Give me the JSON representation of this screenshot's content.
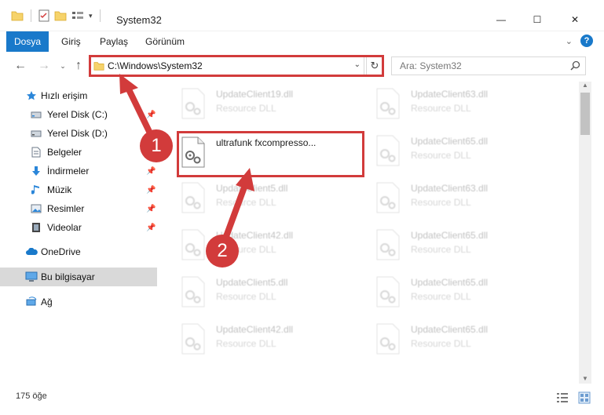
{
  "window": {
    "title": "System32",
    "minimize_glyph": "—",
    "maximize_glyph": "☐",
    "close_glyph": "✕"
  },
  "ribbon": {
    "tabs": [
      "Dosya",
      "Giriş",
      "Paylaş",
      "Görünüm"
    ],
    "accent_color": "#1979ca"
  },
  "navigation": {
    "address": "C:\\Windows\\System32",
    "search_placeholder": "Ara: System32"
  },
  "sidebar": {
    "items": [
      {
        "label": "Hızlı erişim",
        "icon": "star-icon"
      },
      {
        "label": "Yerel Disk (C:)",
        "icon": "drive-icon"
      },
      {
        "label": "Yerel Disk (D:)",
        "icon": "drive-icon"
      },
      {
        "label": "Belgeler",
        "icon": "documents-icon"
      },
      {
        "label": "İndirmeler",
        "icon": "download-icon"
      },
      {
        "label": "Müzik",
        "icon": "music-icon"
      },
      {
        "label": "Resimler",
        "icon": "pictures-icon"
      },
      {
        "label": "Videolar",
        "icon": "videos-icon"
      },
      {
        "label": "OneDrive",
        "icon": "cloud-icon"
      },
      {
        "label": "Bu bilgisayar",
        "icon": "computer-icon"
      },
      {
        "label": "Ağ",
        "icon": "network-icon"
      }
    ]
  },
  "files": {
    "highlighted": {
      "name": "ultrafunk fxcompresso..."
    },
    "left_column": [
      {
        "name": "UpdateClient19.dll",
        "type": "Resource DLL"
      },
      {
        "name": "UpdateClient5.dll",
        "type": "Resource DLL"
      },
      {
        "name": "UpdateClient42.dll",
        "type": "Resource DLL"
      },
      {
        "name": "UpdateClient5.dll",
        "type": "Resource DLL"
      },
      {
        "name": "UpdateClient42.dll",
        "type": "Resource DLL"
      }
    ],
    "right_column": [
      {
        "name": "UpdateClient63.dll",
        "type": "Resource DLL"
      },
      {
        "name": "UpdateClient65.dll",
        "type": "Resource DLL"
      },
      {
        "name": "UpdateClient63.dll",
        "type": "Resource DLL"
      },
      {
        "name": "UpdateClient65.dll",
        "type": "Resource DLL"
      },
      {
        "name": "UpdateClient65.dll",
        "type": "Resource DLL"
      },
      {
        "name": "UpdateClient65.dll",
        "type": "Resource DLL"
      }
    ]
  },
  "status": {
    "item_count": "175 öğe"
  },
  "annotations": {
    "step1": "1",
    "step2": "2",
    "color": "#d23b3b"
  }
}
